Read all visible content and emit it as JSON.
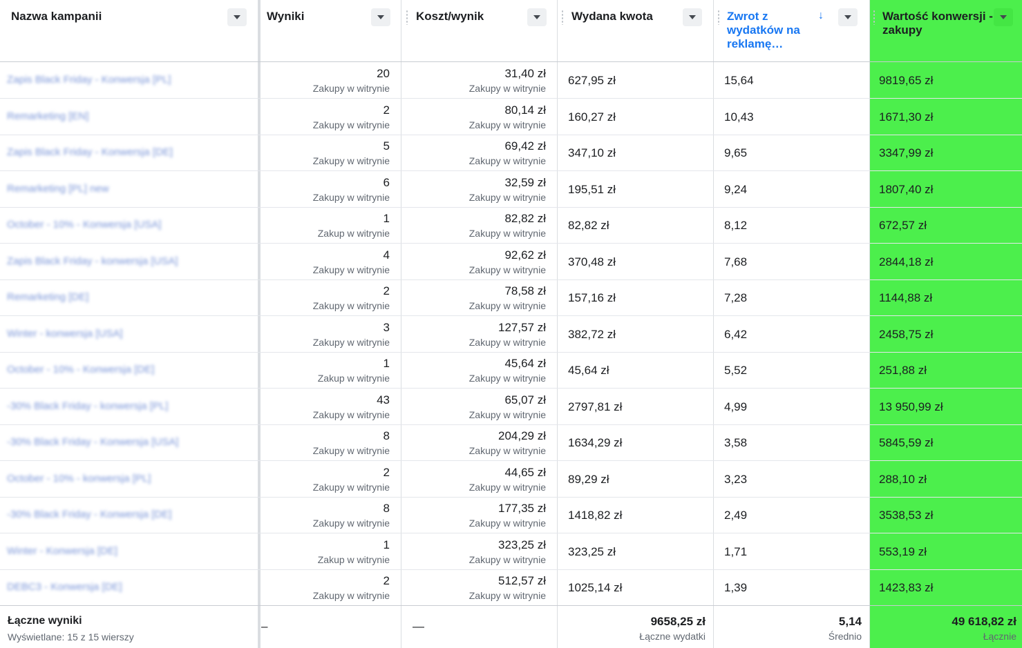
{
  "colors": {
    "highlight": "#4cef4c",
    "sorted": "#1877f2"
  },
  "columns": {
    "name": "Nazwa kampanii",
    "results": "Wyniki",
    "cost": "Koszt/wynik",
    "spent": "Wydana kwota",
    "roas": "Zwrot z wydatków na reklamę…",
    "conv": "Wartość konwersji - zakupy"
  },
  "rows": [
    {
      "name": "Zapis Black Friday - Konwersja [PL]",
      "results": "20",
      "results_label": "Zakupy w witrynie",
      "cost": "31,40 zł",
      "cost_label": "Zakupy w witrynie",
      "spent": "627,95 zł",
      "roas": "15,64",
      "conv": "9819,65 zł"
    },
    {
      "name": "Remarketing [EN]",
      "results": "2",
      "results_label": "Zakupy w witrynie",
      "cost": "80,14 zł",
      "cost_label": "Zakupy w witrynie",
      "spent": "160,27 zł",
      "roas": "10,43",
      "conv": "1671,30 zł"
    },
    {
      "name": "Zapis Black Friday - Konwersja [DE]",
      "results": "5",
      "results_label": "Zakupy w witrynie",
      "cost": "69,42 zł",
      "cost_label": "Zakupy w witrynie",
      "spent": "347,10 zł",
      "roas": "9,65",
      "conv": "3347,99 zł"
    },
    {
      "name": "Remarketing [PL] new",
      "results": "6",
      "results_label": "Zakupy w witrynie",
      "cost": "32,59 zł",
      "cost_label": "Zakupy w witrynie",
      "spent": "195,51 zł",
      "roas": "9,24",
      "conv": "1807,40 zł"
    },
    {
      "name": "October - 10% - Konwersja [USA]",
      "results": "1",
      "results_label": "Zakup w witrynie",
      "cost": "82,82 zł",
      "cost_label": "Zakupy w witrynie",
      "spent": "82,82 zł",
      "roas": "8,12",
      "conv": "672,57 zł"
    },
    {
      "name": "Zapis Black Friday - konwersja [USA]",
      "results": "4",
      "results_label": "Zakupy w witrynie",
      "cost": "92,62 zł",
      "cost_label": "Zakupy w witrynie",
      "spent": "370,48 zł",
      "roas": "7,68",
      "conv": "2844,18 zł"
    },
    {
      "name": "Remarketing [DE]",
      "results": "2",
      "results_label": "Zakupy w witrynie",
      "cost": "78,58 zł",
      "cost_label": "Zakupy w witrynie",
      "spent": "157,16 zł",
      "roas": "7,28",
      "conv": "1144,88 zł"
    },
    {
      "name": "Winter - konwersja [USA]",
      "results": "3",
      "results_label": "Zakupy w witrynie",
      "cost": "127,57 zł",
      "cost_label": "Zakupy w witrynie",
      "spent": "382,72 zł",
      "roas": "6,42",
      "conv": "2458,75 zł"
    },
    {
      "name": "October - 10% - Konwersja [DE]",
      "results": "1",
      "results_label": "Zakup w witrynie",
      "cost": "45,64 zł",
      "cost_label": "Zakupy w witrynie",
      "spent": "45,64 zł",
      "roas": "5,52",
      "conv": "251,88 zł"
    },
    {
      "name": "-30% Black Friday - konwersja [PL]",
      "results": "43",
      "results_label": "Zakupy w witrynie",
      "cost": "65,07 zł",
      "cost_label": "Zakupy w witrynie",
      "spent": "2797,81 zł",
      "roas": "4,99",
      "conv": "13 950,99 zł"
    },
    {
      "name": "-30% Black Friday - Konwersja [USA]",
      "results": "8",
      "results_label": "Zakupy w witrynie",
      "cost": "204,29 zł",
      "cost_label": "Zakupy w witrynie",
      "spent": "1634,29 zł",
      "roas": "3,58",
      "conv": "5845,59 zł"
    },
    {
      "name": "October - 10% - konwersja [PL]",
      "results": "2",
      "results_label": "Zakupy w witrynie",
      "cost": "44,65 zł",
      "cost_label": "Zakupy w witrynie",
      "spent": "89,29 zł",
      "roas": "3,23",
      "conv": "288,10 zł"
    },
    {
      "name": "-30% Black Friday - Konwersja [DE]",
      "results": "8",
      "results_label": "Zakupy w witrynie",
      "cost": "177,35 zł",
      "cost_label": "Zakupy w witrynie",
      "spent": "1418,82 zł",
      "roas": "2,49",
      "conv": "3538,53 zł"
    },
    {
      "name": "Winter - Konwersja [DE]",
      "results": "1",
      "results_label": "Zakup w witrynie",
      "cost": "323,25 zł",
      "cost_label": "Zakupy w witrynie",
      "spent": "323,25 zł",
      "roas": "1,71",
      "conv": "553,19 zł"
    },
    {
      "name": "DEBC3 - Konwersja [DE]",
      "results": "2",
      "results_label": "Zakupy w witrynie",
      "cost": "512,57 zł",
      "cost_label": "Zakupy w witrynie",
      "spent": "1025,14 zł",
      "roas": "1,39",
      "conv": "1423,83 zł"
    }
  ],
  "footer": {
    "title": "Łączne wyniki",
    "subtitle": "Wyświetlane: 15 z 15 wierszy",
    "results": "–",
    "cost": "—",
    "spent": "9658,25 zł",
    "spent_label": "Łączne wydatki",
    "roas": "5,14",
    "roas_label": "Średnio",
    "conv": "49 618,82 zł",
    "conv_label": "Łącznie"
  },
  "icons": {
    "dropdown": "caret-down-icon",
    "sort": "arrow-down-icon",
    "drag": "drag-handle-icon"
  },
  "sort_arrow": "↓"
}
